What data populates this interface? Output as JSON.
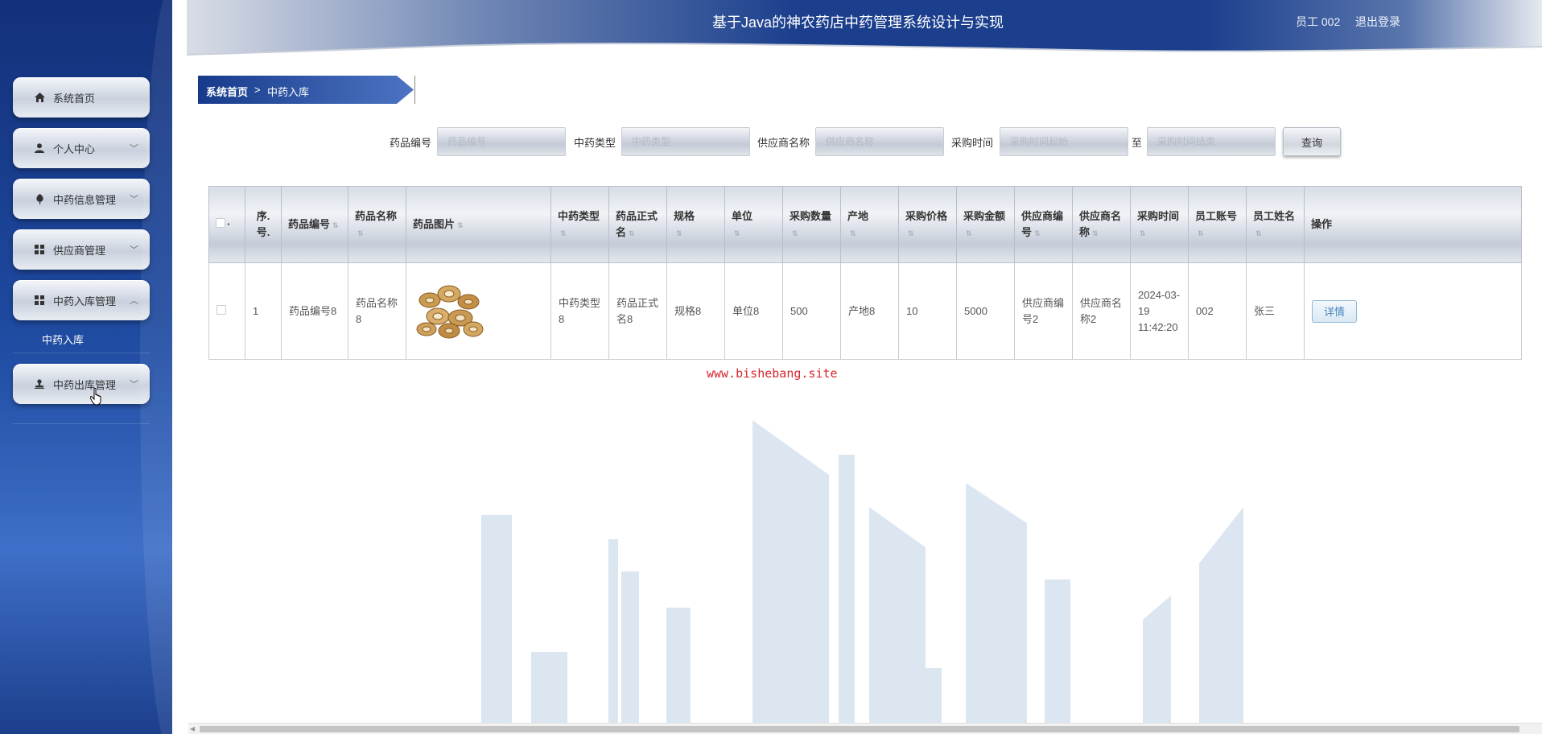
{
  "header": {
    "title": "基于Java的神农药店中药管理系统设计与实现",
    "user_label": "员工 002",
    "logout_label": "退出登录"
  },
  "sidebar": {
    "items": [
      {
        "label": "系统首页",
        "icon": "home-icon",
        "expand": false
      },
      {
        "label": "个人中心",
        "icon": "user-icon",
        "expand": true
      },
      {
        "label": "中药信息管理",
        "icon": "leaf-icon",
        "expand": true
      },
      {
        "label": "供应商管理",
        "icon": "grid-icon",
        "expand": true
      },
      {
        "label": "中药入库管理",
        "icon": "grid-icon",
        "expand": true
      }
    ],
    "submenu_active": "中药入库",
    "last_item": {
      "label": "中药出库管理",
      "icon": "stamp-icon"
    }
  },
  "breadcrumb": {
    "home": "系统首页",
    "separator": ">",
    "current": "中药入库"
  },
  "search": {
    "fields": [
      {
        "label": "药品编号",
        "placeholder": "药品编号"
      },
      {
        "label": "中药类型",
        "placeholder": "中药类型"
      },
      {
        "label": "供应商名称",
        "placeholder": "供应商名称"
      },
      {
        "label": "采购时间",
        "placeholder": "采购时间起始"
      }
    ],
    "range_sep": "至",
    "end_placeholder": "采购时间结束",
    "button_label": "查询"
  },
  "table": {
    "headers": [
      "",
      "序.号.",
      "药品编号",
      "药品名称",
      "药品图片",
      "中药类型",
      "药品正式名",
      "规格",
      "单位",
      "采购数量",
      "产地",
      "采购价格",
      "采购金额",
      "供应商编号",
      "供应商名称",
      "采购时间",
      "员工账号",
      "员工姓名",
      "操作"
    ],
    "rows": [
      {
        "index": "1",
        "drug_no": "药品编号8",
        "drug_name": "药品名称8",
        "herb_type": "中药类型8",
        "formal_name": "药品正式名8",
        "spec": "规格8",
        "unit": "单位8",
        "qty": "500",
        "origin": "产地8",
        "price": "10",
        "amount": "5000",
        "supplier_no": "供应商编号2",
        "supplier_name": "供应商名称2",
        "purchase_time": "2024-03-19 11:42:20",
        "staff_account": "002",
        "staff_name": "张三",
        "action_label": "详情"
      }
    ]
  },
  "watermark": "www.bishebang.site",
  "colors": {
    "sidebar": "#1e4aa0",
    "header": "#1a3f8e",
    "watermark": "#d7262e",
    "detail_button": "#4a86c0"
  }
}
